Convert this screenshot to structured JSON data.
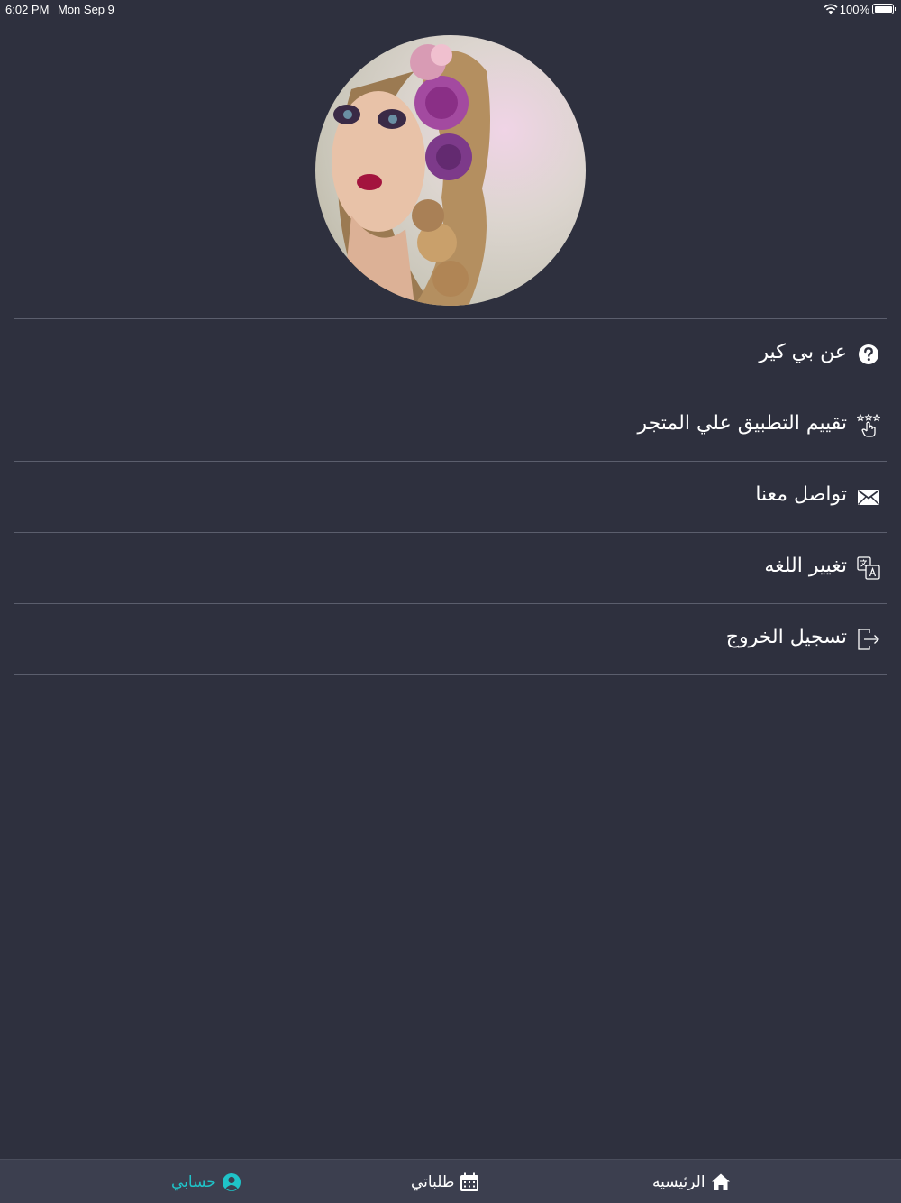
{
  "status_bar": {
    "time": "6:02 PM",
    "date": "Mon Sep 9",
    "battery": "100%"
  },
  "profile": {
    "avatar_icon": "avatar-photo"
  },
  "menu": {
    "items": [
      {
        "label": "عن بي كير",
        "icon": "question-circle-icon"
      },
      {
        "label": "تقييم التطبيق علي المتجر",
        "icon": "rate-stars-hand-icon"
      },
      {
        "label": "تواصل معنا",
        "icon": "envelope-icon"
      },
      {
        "label": "تغيير اللغه",
        "icon": "translate-icon"
      },
      {
        "label": "تسجيل الخروج",
        "icon": "logout-icon"
      }
    ]
  },
  "tab_bar": {
    "home": "الرئيسيه",
    "orders": "طلباتي",
    "account": "حسابي"
  },
  "colors": {
    "background": "#2e303e",
    "tab_bar": "#3c3f4f",
    "accent": "#1fc3c8",
    "divider": "#5b5e6d"
  }
}
